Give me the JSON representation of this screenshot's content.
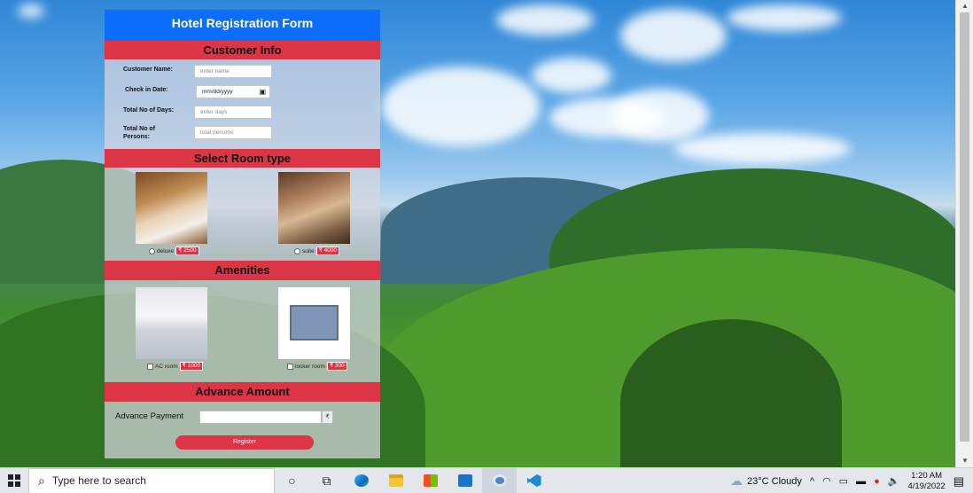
{
  "form": {
    "title": "Hotel Registration Form",
    "sections": {
      "customer_info": "Customer Info",
      "room_type": "Select Room type",
      "amenities": "Amenities",
      "advance": "Advance Amount"
    },
    "fields": {
      "name_label": "Customer Name:",
      "name_placeholder": "enter name",
      "date_label": "Check in Date:",
      "date_placeholder": "mm/dd/yyyy",
      "days_label": "Total No of Days:",
      "days_placeholder": "enter days",
      "persons_label": "Total No of Persons:",
      "persons_placeholder": "total persons"
    },
    "rooms": [
      {
        "label": "deluxe",
        "price": "₹ 2500"
      },
      {
        "label": "suite",
        "price": "₹ 4000"
      }
    ],
    "amenities": [
      {
        "label": "AC room",
        "price": "₹ 1000"
      },
      {
        "label": "locker room",
        "price": "₹ 300"
      }
    ],
    "advance_label": "Advance Payment",
    "advance_unit": "₹",
    "register_label": "Register"
  },
  "taskbar": {
    "search_placeholder": "Type here to search",
    "weather": "23°C  Cloudy",
    "time": "1:20 AM",
    "date": "4/19/2022"
  },
  "colors": {
    "header": "#0d6efd",
    "section": "#dc3545"
  }
}
